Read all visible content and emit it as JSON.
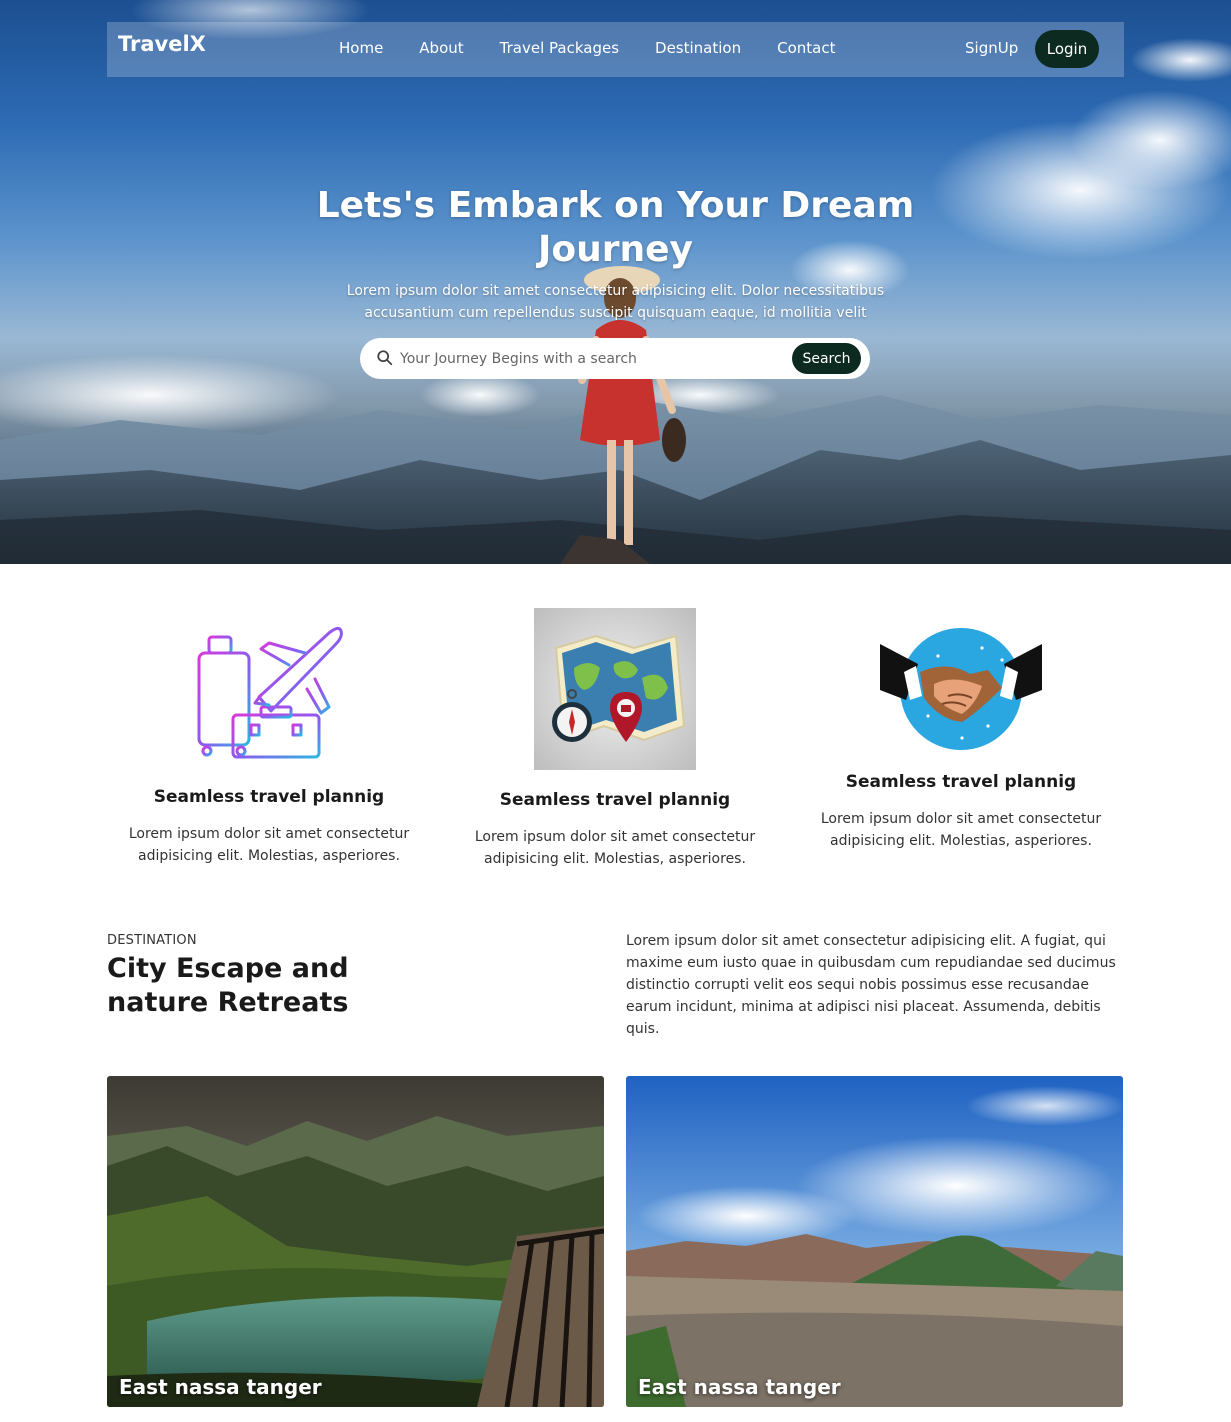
{
  "nav": {
    "brand": "TravelX",
    "links": [
      "Home",
      "About",
      "Travel Packages",
      "Destination",
      "Contact"
    ],
    "signup": "SignUp",
    "login": "Login"
  },
  "hero": {
    "title": "Lets's Embark on Your Dream Journey",
    "subtitle": "Lorem ipsum dolor sit amet consectetur adipisicing elit. Dolor necessitatibus accusantium cum repellendus suscipit quisquam eaque, id mollitia velit",
    "search_placeholder": "Your Journey Begins with a search",
    "search_button": "Search"
  },
  "features": [
    {
      "title": "Seamless travel plannig",
      "text": "Lorem ipsum dolor sit amet consectetur adipisicing elit. Molestias, asperiores.",
      "icon": "luggage-airplane-icon"
    },
    {
      "title": "Seamless travel plannig",
      "text": "Lorem ipsum dolor sit amet consectetur adipisicing elit. Molestias, asperiores.",
      "icon": "map-compass-icon"
    },
    {
      "title": "Seamless travel plannig",
      "text": "Lorem ipsum dolor sit amet consectetur adipisicing elit. Molestias, asperiores.",
      "icon": "handshake-icon"
    }
  ],
  "destination": {
    "eyebrow": "DESTINATION",
    "heading": "City Escape and nature Retreats",
    "paragraph": "Lorem ipsum dolor sit amet consectetur adipisicing elit. A fugiat, qui maxime eum iusto quae in quibusdam cum repudiandae sed ducimus distinctio corrupti velit eos sequi nobis possimus esse recusandae earum incidunt, minima at adipisci nisi placeat. Assumenda, debitis quis.",
    "cards": [
      {
        "label": "East nassa tanger"
      },
      {
        "label": "East nassa tanger"
      }
    ]
  },
  "colors": {
    "accent_dark": "#0c2a1f",
    "sky": "#2d6bb4"
  }
}
